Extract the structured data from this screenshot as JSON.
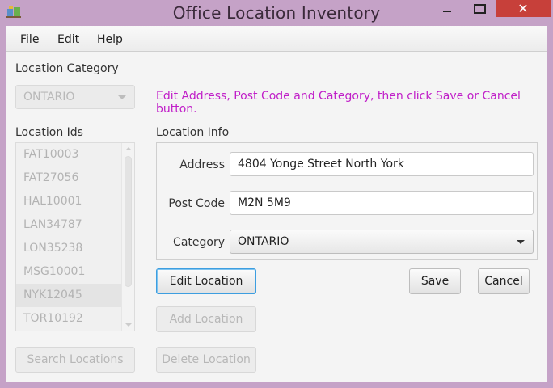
{
  "window": {
    "title": "Office Location Inventory",
    "close_glyph": "✕"
  },
  "menu": [
    "File",
    "Edit",
    "Help"
  ],
  "category": {
    "label": "Location Category",
    "selected": "ONTARIO"
  },
  "hint": "Edit Address, Post Code and Category, then click Save or Cancel button.",
  "ids": {
    "label": "Location Ids",
    "items": [
      "FAT10003",
      "FAT27056",
      "HAL10001",
      "LAN34787",
      "LON35238",
      "MSG10001",
      "NYK12045",
      "TOR10192"
    ],
    "selected": "NYK12045"
  },
  "info": {
    "label": "Location Info",
    "address_label": "Address",
    "address_value": "4804 Yonge Street North York",
    "postcode_label": "Post Code",
    "postcode_value": "M2N 5M9",
    "category_label": "Category",
    "category_value": "ONTARIO"
  },
  "buttons": {
    "edit": "Edit Location",
    "save": "Save",
    "cancel": "Cancel",
    "add": "Add Location",
    "search": "Search Locations",
    "delete": "Delete Location"
  },
  "colors": {
    "hint": "#c01ec8",
    "close_button": "#c7403a",
    "title_bar": "#c5a2c7",
    "focus": "#3d9ee0"
  },
  "icons": [
    "app-icon",
    "minimize-icon",
    "maximize-icon",
    "close-icon",
    "dropdown-arrow-icon",
    "scroll-up-icon",
    "scroll-down-icon"
  ]
}
